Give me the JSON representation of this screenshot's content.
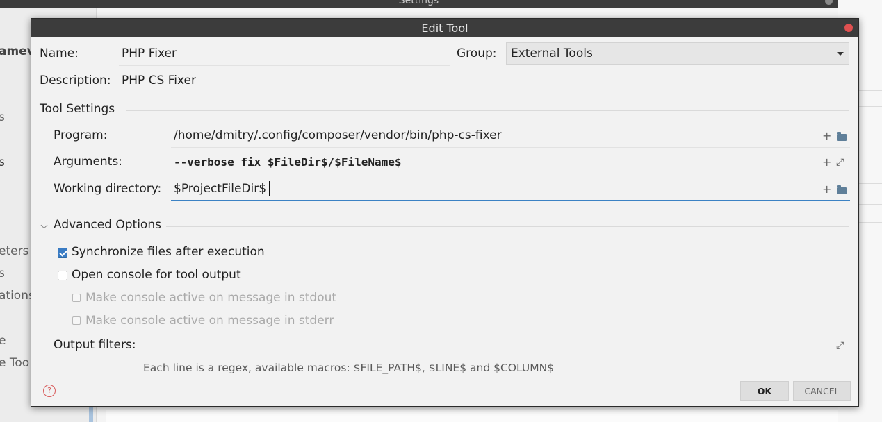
{
  "background": {
    "window_title": "Settings",
    "sidebar_items": [
      "amev",
      "s",
      "s",
      "eters",
      "s",
      "ations",
      "e",
      "e Too"
    ]
  },
  "dialog": {
    "title": "Edit Tool",
    "name_label": "Name:",
    "name_value": "PHP Fixer",
    "group_label": "Group:",
    "group_value": "External Tools",
    "description_label": "Description:",
    "description_value": "PHP CS Fixer",
    "tool_settings_title": "Tool Settings",
    "program_label": "Program:",
    "program_value": "/home/dmitry/.config/composer/vendor/bin/php-cs-fixer",
    "arguments_label": "Arguments:",
    "arguments_value": "--verbose fix $FileDir$/$FileName$",
    "working_dir_label": "Working directory:",
    "working_dir_value": "$ProjectFileDir$",
    "advanced_title": "Advanced Options",
    "sync_label": "Synchronize files after execution",
    "sync_checked": true,
    "console_label": "Open console for tool output",
    "console_checked": false,
    "stdout_label": "Make console active on message in stdout",
    "stderr_label": "Make console active on message in stderr",
    "output_filters_label": "Output filters:",
    "hint": "Each line is a regex, available macros: $FILE_PATH$, $LINE$ and $COLUMN$",
    "ok_label": "OK",
    "cancel_label": "CANCEL",
    "help_glyph": "?"
  },
  "icons": {
    "add": "+",
    "expand": "⤢"
  },
  "colors": {
    "accent": "#3b82c4",
    "titlebar": "#3c3c3c",
    "close": "#e05050"
  }
}
